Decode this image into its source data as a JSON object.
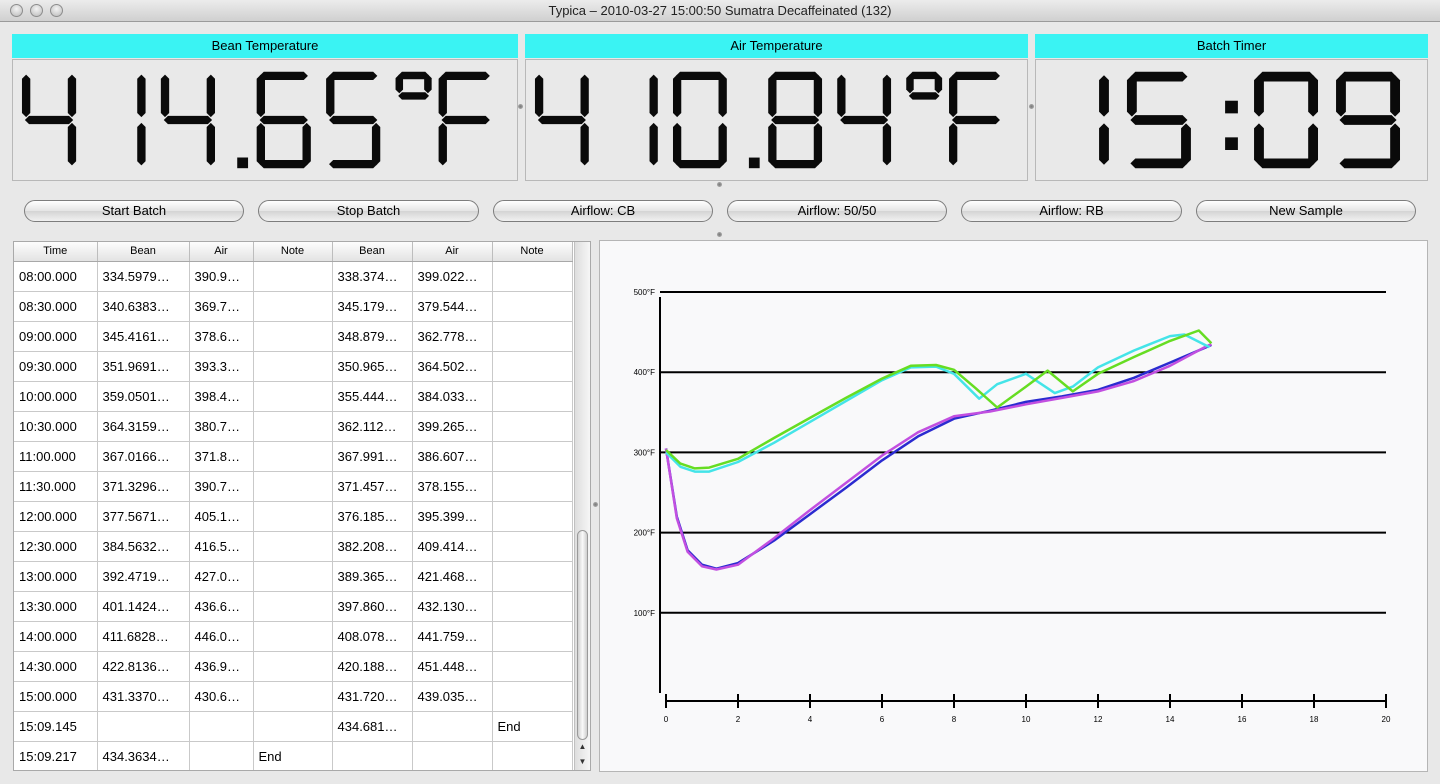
{
  "window": {
    "title": "Typica – 2010-03-27 15:00:50 Sumatra Decaffeinated (132)"
  },
  "displays": [
    {
      "label": "Bean Temperature",
      "value": "414.65°F"
    },
    {
      "label": "Air Temperature",
      "value": "410.84°F"
    },
    {
      "label": "Batch Timer",
      "value": "15:09"
    }
  ],
  "buttons": [
    {
      "label": "Start Batch"
    },
    {
      "label": "Stop Batch"
    },
    {
      "label": "Airflow: CB"
    },
    {
      "label": "Airflow: 50/50"
    },
    {
      "label": "Airflow: RB"
    },
    {
      "label": "New Sample"
    }
  ],
  "table": {
    "columns": [
      "Time",
      "Bean",
      "Air",
      "Note",
      "Bean",
      "Air",
      "Note"
    ],
    "rows": [
      [
        "08:00.000",
        "334.5979…",
        "390.9…",
        "",
        "338.374…",
        "399.022…",
        ""
      ],
      [
        "08:30.000",
        "340.6383…",
        "369.7…",
        "",
        "345.179…",
        "379.544…",
        ""
      ],
      [
        "09:00.000",
        "345.4161…",
        "378.6…",
        "",
        "348.879…",
        "362.778…",
        ""
      ],
      [
        "09:30.000",
        "351.9691…",
        "393.3…",
        "",
        "350.965…",
        "364.502…",
        ""
      ],
      [
        "10:00.000",
        "359.0501…",
        "398.4…",
        "",
        "355.444…",
        "384.033…",
        ""
      ],
      [
        "10:30.000",
        "364.3159…",
        "380.7…",
        "",
        "362.112…",
        "399.265…",
        ""
      ],
      [
        "11:00.000",
        "367.0166…",
        "371.8…",
        "",
        "367.991…",
        "386.607…",
        ""
      ],
      [
        "11:30.000",
        "371.3296…",
        "390.7…",
        "",
        "371.457…",
        "378.155…",
        ""
      ],
      [
        "12:00.000",
        "377.5671…",
        "405.1…",
        "",
        "376.185…",
        "395.399…",
        ""
      ],
      [
        "12:30.000",
        "384.5632…",
        "416.5…",
        "",
        "382.208…",
        "409.414…",
        ""
      ],
      [
        "13:00.000",
        "392.4719…",
        "427.0…",
        "",
        "389.365…",
        "421.468…",
        ""
      ],
      [
        "13:30.000",
        "401.1424…",
        "436.6…",
        "",
        "397.860…",
        "432.130…",
        ""
      ],
      [
        "14:00.000",
        "411.6828…",
        "446.0…",
        "",
        "408.078…",
        "441.759…",
        ""
      ],
      [
        "14:30.000",
        "422.8136…",
        "436.9…",
        "",
        "420.188…",
        "451.448…",
        ""
      ],
      [
        "15:00.000",
        "431.3370…",
        "430.6…",
        "",
        "431.720…",
        "439.035…",
        ""
      ],
      [
        "15:09.145",
        "",
        "",
        "",
        "434.681…",
        "",
        "End"
      ],
      [
        "15:09.217",
        "434.3634…",
        "",
        "End",
        "",
        "",
        ""
      ]
    ]
  },
  "chart_data": {
    "type": "line",
    "title": "",
    "xlabel": "",
    "ylabel": "",
    "xlim": [
      0,
      20
    ],
    "ylim": [
      0,
      500
    ],
    "xticks": [
      0,
      2,
      4,
      6,
      8,
      10,
      12,
      14,
      16,
      18,
      20
    ],
    "yticks": [
      100,
      200,
      300,
      400,
      500
    ],
    "ytick_labels": [
      "100°F",
      "200°F",
      "300°F",
      "400°F",
      "500°F"
    ],
    "grid": "horizontal",
    "series": [
      {
        "color": "#2b2bd0",
        "x": [
          0,
          0.3,
          0.6,
          1.0,
          1.4,
          2.0,
          3.0,
          4.0,
          5.0,
          6.0,
          7.0,
          8.0,
          9.0,
          10.0,
          11.0,
          12.0,
          13.0,
          14.0,
          15.0,
          15.15
        ],
        "y": [
          305,
          220,
          178,
          160,
          155,
          162,
          190,
          223,
          256,
          290,
          320,
          342,
          352,
          363,
          370,
          378,
          393,
          412,
          431,
          434
        ]
      },
      {
        "color": "#c24fe0",
        "x": [
          0,
          0.3,
          0.6,
          1.0,
          1.4,
          2.0,
          3.0,
          4.0,
          5.0,
          6.0,
          7.0,
          8.0,
          9.0,
          10.0,
          11.0,
          12.0,
          13.0,
          14.0,
          15.0,
          15.15
        ],
        "y": [
          305,
          218,
          176,
          158,
          154,
          160,
          193,
          228,
          262,
          296,
          325,
          345,
          351,
          360,
          368,
          376,
          389,
          408,
          432,
          435
        ]
      },
      {
        "color": "#44e4e8",
        "x": [
          0,
          0.4,
          0.8,
          1.2,
          2.0,
          3.0,
          4.0,
          5.0,
          6.0,
          6.8,
          7.5,
          8.0,
          8.7,
          9.2,
          10.0,
          10.8,
          11.3,
          12.0,
          13.0,
          14.0,
          14.4,
          15.1
        ],
        "y": [
          300,
          282,
          276,
          276,
          288,
          312,
          338,
          364,
          390,
          406,
          407,
          398,
          367,
          385,
          398,
          374,
          382,
          406,
          427,
          445,
          447,
          431
        ]
      },
      {
        "color": "#66dd22",
        "x": [
          0,
          0.4,
          0.8,
          1.2,
          2.0,
          3.0,
          4.0,
          5.0,
          6.0,
          6.8,
          7.5,
          8.0,
          8.6,
          9.2,
          10.0,
          10.6,
          11.3,
          12.0,
          13.0,
          14.0,
          14.8,
          15.15
        ],
        "y": [
          303,
          286,
          280,
          281,
          292,
          318,
          343,
          368,
          392,
          408,
          409,
          403,
          380,
          356,
          382,
          402,
          376,
          398,
          419,
          439,
          452,
          436
        ]
      }
    ]
  }
}
